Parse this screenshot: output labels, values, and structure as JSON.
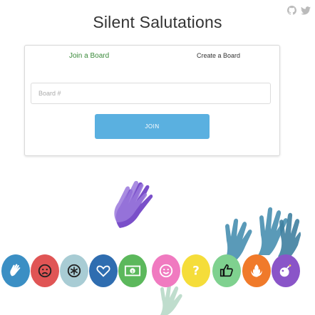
{
  "header": {
    "title": "Silent Salutations",
    "icons": [
      "github-icon",
      "twitter-icon"
    ]
  },
  "card": {
    "tabs": [
      {
        "label": "Join a Board",
        "active": true
      },
      {
        "label": "Create a Board",
        "active": false
      }
    ],
    "board_input": {
      "placeholder": "Board #",
      "value": ""
    },
    "join_label": "JOIN"
  },
  "reactions": [
    {
      "icon": "wave-hand-icon",
      "color": "#3b8fc4"
    },
    {
      "icon": "sad-face-icon",
      "color": "#e05555"
    },
    {
      "icon": "snowflake-icon",
      "color": "#a8ccd4"
    },
    {
      "icon": "heart-icon",
      "color": "#2f6db0"
    },
    {
      "icon": "money-icon",
      "color": "#5cb85c"
    },
    {
      "icon": "smile-icon",
      "color": "#f07ac0"
    },
    {
      "icon": "question-icon",
      "color": "#f5dd3a"
    },
    {
      "icon": "thumbs-up-icon",
      "color": "#7fd18f"
    },
    {
      "icon": "rebel-icon",
      "color": "#f07a2a"
    },
    {
      "icon": "bomb-icon",
      "color": "#8a55c8"
    }
  ],
  "colors": {
    "accent_green": "#3a8a3a",
    "join_button": "#5ab0e0",
    "hands_purple": "#7a4fc9",
    "hands_teal": "#5a9ab8"
  }
}
